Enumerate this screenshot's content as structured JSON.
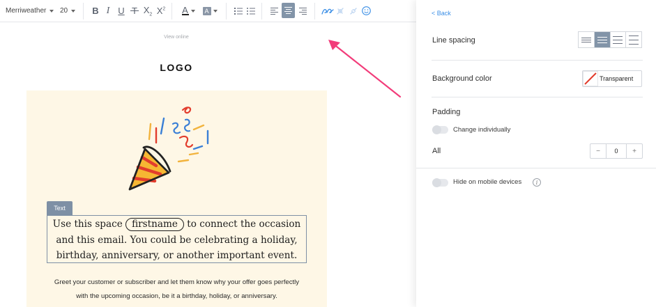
{
  "toolbar": {
    "font_family": "Merriweather",
    "font_size": "20",
    "bold": "B",
    "italic": "I",
    "underline": "U",
    "strike": "T",
    "subscript_base": "X",
    "subscript_mark": "2",
    "superscript_base": "X",
    "superscript_mark": "2",
    "text_color_letter": "A",
    "bg_color_letter": "A",
    "icons": [
      "caret-down-icon",
      "bold-icon",
      "italic-icon",
      "underline-icon",
      "strikethrough-icon",
      "subscript-icon",
      "superscript-icon",
      "text-color-icon",
      "highlight-color-icon",
      "ordered-list-icon",
      "unordered-list-icon",
      "align-left-icon",
      "align-center-icon",
      "align-right-icon",
      "link-icon",
      "unlink-icon",
      "emoji-icon"
    ],
    "accent_color": "#8294a8",
    "link_color": "#3a8ee6"
  },
  "email": {
    "view_online": "View online",
    "logo": "LOGO",
    "block_tag": "Text",
    "text_before": "Use this space",
    "merge_tag": "firstname",
    "text_after": "to connect the occasion and this email. You could be celebrating a holiday, birthday, anniversary, or another important event.",
    "body_text": "Greet your customer or subscriber and let them know why your offer goes perfectly with the upcoming occasion, be it a birthday, holiday, or anniversary.",
    "card_bg_color": "#fef7e6"
  },
  "panel": {
    "back": "< Back",
    "line_spacing_label": "Line spacing",
    "line_spacing_selected": 1,
    "background_color_label": "Background color",
    "background_color_value": "Transparent",
    "padding_label": "Padding",
    "change_individually_label": "Change individually",
    "change_individually_on": false,
    "all_label": "All",
    "minus": "−",
    "padding_value": "0",
    "plus": "+",
    "hide_mobile_label": "Hide on mobile devices",
    "hide_mobile_on": false,
    "info": "i"
  }
}
